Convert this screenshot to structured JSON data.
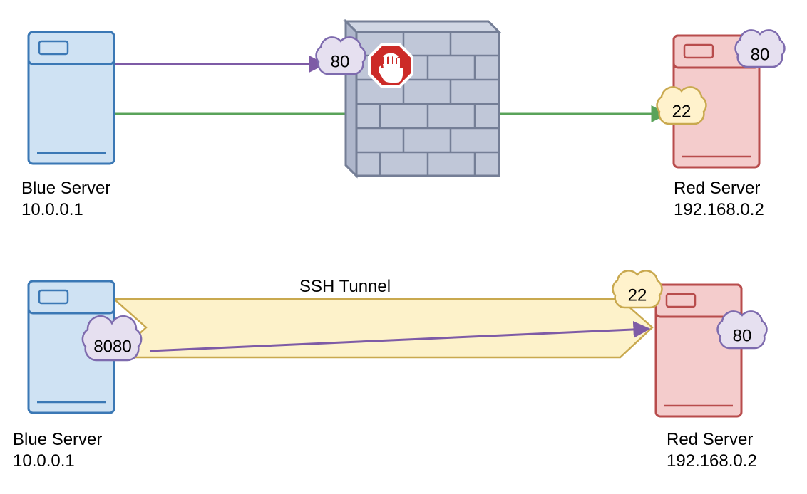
{
  "top": {
    "blue_server": {
      "name": "Blue Server",
      "ip": "10.0.0.1"
    },
    "red_server": {
      "name": "Red Server",
      "ip": "192.168.0.2"
    },
    "firewall_blocked_port": "80",
    "red_port_http_label": "80",
    "red_port_ssh_label": "22"
  },
  "bottom": {
    "blue_server": {
      "name": "Blue Server",
      "ip": "10.0.0.1"
    },
    "red_server": {
      "name": "Red Server",
      "ip": "192.168.0.2"
    },
    "tunnel_label": "SSH Tunnel",
    "blue_local_port_label": "8080",
    "red_port_ssh_label": "22",
    "red_port_http_label": "80"
  },
  "colors": {
    "blue_fill": "#CFE2F3",
    "blue_stroke": "#3B78B5",
    "red_fill": "#F4CCCC",
    "red_stroke": "#B84C4C",
    "wall_fill": "#C0C7D8",
    "wall_stroke": "#747E96",
    "purple_cloud_fill": "#E6E0F0",
    "purple_cloud_stroke": "#7E6BAE",
    "yellow_cloud_fill": "#FFF2CC",
    "yellow_cloud_stroke": "#C9A94F",
    "tunnel_fill": "#FDF2CA",
    "tunnel_stroke": "#C9A94F",
    "arrow_purple": "#7E5BA6",
    "arrow_green": "#5AA35A",
    "stop_red": "#CC2A27"
  }
}
